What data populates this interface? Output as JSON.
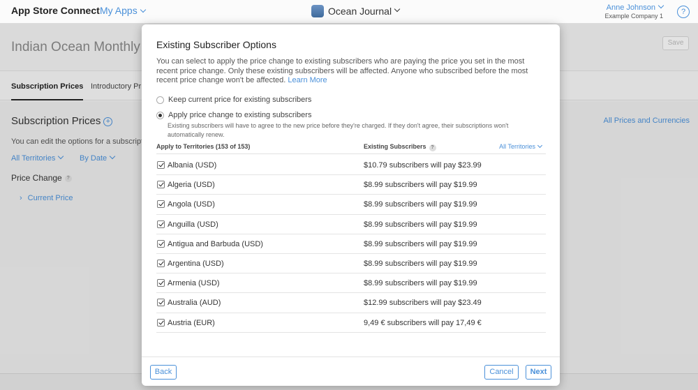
{
  "header": {
    "brand": "App Store Connect",
    "my_apps": "My Apps",
    "app_name": "Ocean Journal",
    "user_name": "Anne Johnson",
    "company": "Example Company 1",
    "help": "?"
  },
  "page": {
    "title": "Indian Ocean Monthly",
    "save_label": "Save",
    "tabs": [
      "Subscription Prices",
      "Introductory Pr"
    ],
    "section_title": "Subscription Prices",
    "all_prices_link": "All Prices and Currencies",
    "edit_desc": "You can edit the options for a subscript",
    "filter_territories": "All Territories",
    "filter_date": "By Date",
    "price_change": "Price Change",
    "current_price": "Current Price"
  },
  "modal": {
    "title": "Existing Subscriber Options",
    "description": "You can select to apply the price change to existing subscribers who are paying the price you set in the most recent price change. Only these existing subscribers will be affected. Anyone who subscribed before the most recent price change won't be affected.",
    "learn_more": "Learn More",
    "option_keep": "Keep current price for existing subscribers",
    "option_apply": "Apply price change to existing subscribers",
    "option_apply_desc": "Existing subscribers will have to agree to the new price before they're charged. If they don't agree, their subscriptions won't automatically renew.",
    "selected_option": "apply",
    "col_territories": "Apply to Territories (153 of 153)",
    "col_subscribers": "Existing Subscribers",
    "filter_label": "All Territories",
    "rows": [
      {
        "territory": "Albania (USD)",
        "subscribers": "$10.79 subscribers will pay $23.99",
        "checked": true
      },
      {
        "territory": "Algeria (USD)",
        "subscribers": "$8.99 subscribers will pay $19.99",
        "checked": true
      },
      {
        "territory": "Angola (USD)",
        "subscribers": "$8.99 subscribers will pay $19.99",
        "checked": true
      },
      {
        "territory": "Anguilla (USD)",
        "subscribers": "$8.99 subscribers will pay $19.99",
        "checked": true
      },
      {
        "territory": "Antigua and Barbuda (USD)",
        "subscribers": "$8.99 subscribers will pay $19.99",
        "checked": true
      },
      {
        "territory": "Argentina (USD)",
        "subscribers": "$8.99 subscribers will pay $19.99",
        "checked": true
      },
      {
        "territory": "Armenia (USD)",
        "subscribers": "$8.99 subscribers will pay $19.99",
        "checked": true
      },
      {
        "territory": "Australia (AUD)",
        "subscribers": "$12.99 subscribers will pay $23.49",
        "checked": true
      },
      {
        "territory": "Austria (EUR)",
        "subscribers": "9,49 € subscribers will pay 17,49 €",
        "checked": true
      }
    ],
    "back_label": "Back",
    "cancel_label": "Cancel",
    "next_label": "Next"
  }
}
